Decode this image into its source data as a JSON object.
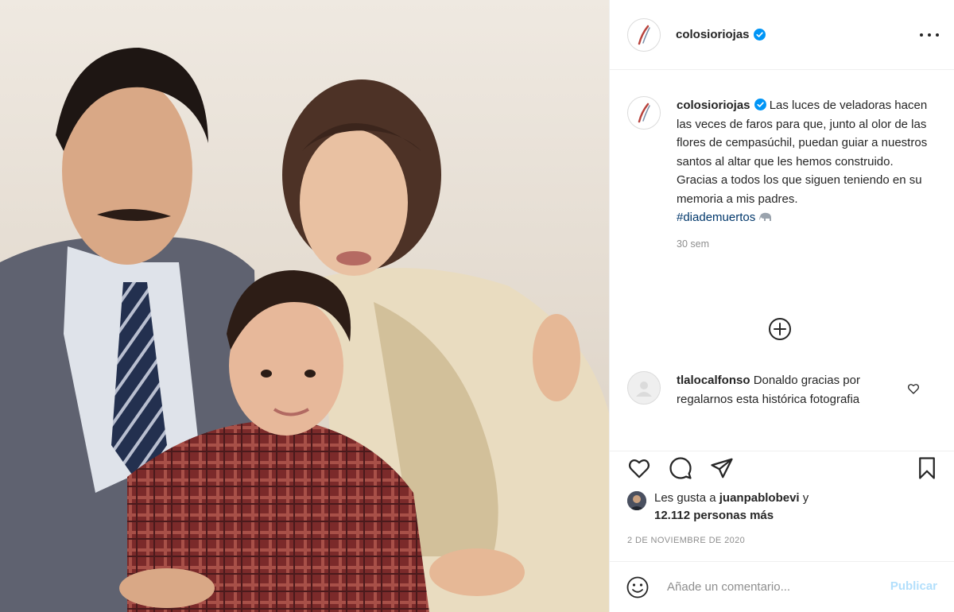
{
  "post": {
    "account": {
      "username": "colosioriojas",
      "verified": true,
      "avatar_icon": "signature-logo-icon"
    },
    "more_icon": "more-options-icon",
    "caption": {
      "username": "colosioriojas",
      "text": "Las luces de veladoras hacen las veces de faros para que, junto al olor de las flores de cempasúchil, puedan guiar a nuestros santos al altar que les hemos construido.\nGracias a todos los que siguen teniendo en su memoria a mis padres.",
      "hashtag": "#diademuertos",
      "emoji": "elephant-icon",
      "time": "30 sem"
    },
    "load_more_icon": "plus-circle-icon",
    "comments": [
      {
        "username": "tlalocalfonso",
        "text": "Donaldo gracias por regalarnos esta histórica fotografia"
      }
    ],
    "actions": [
      "heart-icon",
      "comment-icon",
      "share-icon",
      "bookmark-icon"
    ],
    "likes": {
      "prefix": "Les gusta a",
      "first_user": "juanpablobevi",
      "connector": "y",
      "others": "12.112 personas más"
    },
    "date": "2 DE NOVIEMBRE DE 2020",
    "add_comment": {
      "placeholder": "Añade un comentario...",
      "post_label": "Publicar",
      "emoji_icon": "smiley-icon"
    }
  },
  "colors": {
    "text": "#262626",
    "secondary": "#8e8e8e",
    "hashtag": "#00376b",
    "verified": "#0095f6",
    "post_button_disabled": "#b2dffc",
    "divider": "#efefef"
  }
}
